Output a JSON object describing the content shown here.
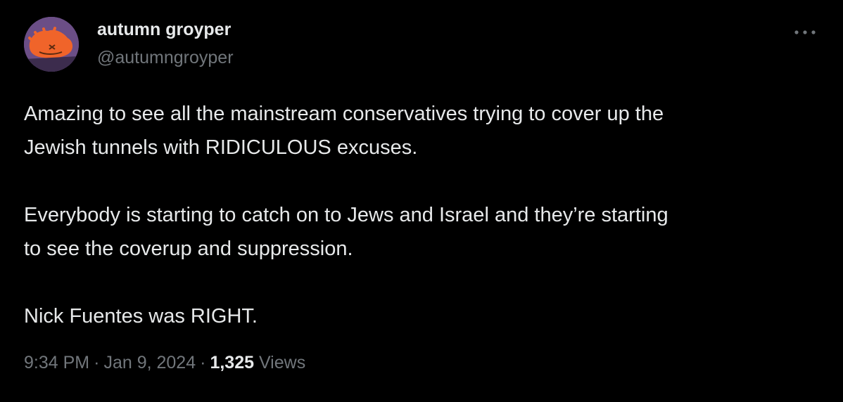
{
  "colors": {
    "background": "#000000",
    "primary_text": "#e7e9ea",
    "secondary_text": "#71767b",
    "avatar_bg": "#6b4e86",
    "avatar_accent": "#f0642a"
  },
  "author": {
    "display_name": "autumn groyper",
    "handle": "@autumngroyper",
    "avatar_icon": "avatar-cartoon-face"
  },
  "more_icon": "ellipsis-horizontal-icon",
  "tweet": {
    "lines": [
      "Amazing to see all the mainstream conservatives trying to cover up the",
      "Jewish tunnels with RIDICULOUS excuses.",
      "Everybody is starting to catch on to Jews and Israel and they’re starting",
      "to see the coverup and suppression.",
      "Nick Fuentes was RIGHT."
    ]
  },
  "meta": {
    "time": "9:34 PM",
    "separator": "·",
    "date": "Jan 9, 2024",
    "views_count": "1,325",
    "views_label": "Views"
  }
}
